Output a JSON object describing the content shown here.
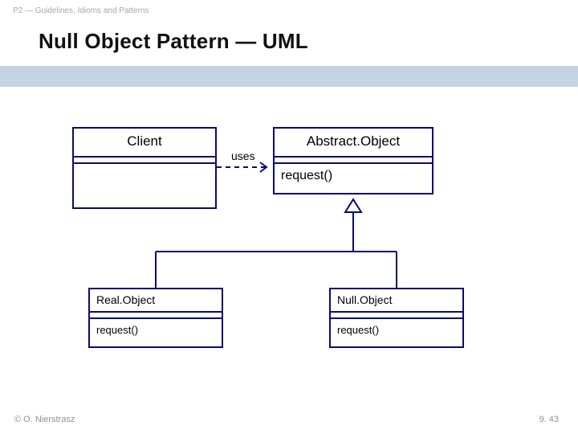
{
  "header": {
    "breadcrumb": "P2 — Guidelines, Idioms and Patterns",
    "title": "Null Object Pattern — UML"
  },
  "diagram": {
    "classes": {
      "client": {
        "name": "Client",
        "operations": []
      },
      "abstract_object": {
        "name": "Abstract.Object",
        "operations": [
          "request()"
        ]
      },
      "real_object": {
        "name": "Real.Object",
        "operations": [
          "request()"
        ]
      },
      "null_object": {
        "name": "Null.Object",
        "operations": [
          "request()"
        ]
      }
    },
    "relationships": {
      "uses_label": "uses"
    }
  },
  "footer": {
    "copyright": "© O. Nierstrasz",
    "page_number": "9. 43"
  },
  "colors": {
    "banner": "#c4d2e3",
    "class_border": "#0a0a70"
  }
}
